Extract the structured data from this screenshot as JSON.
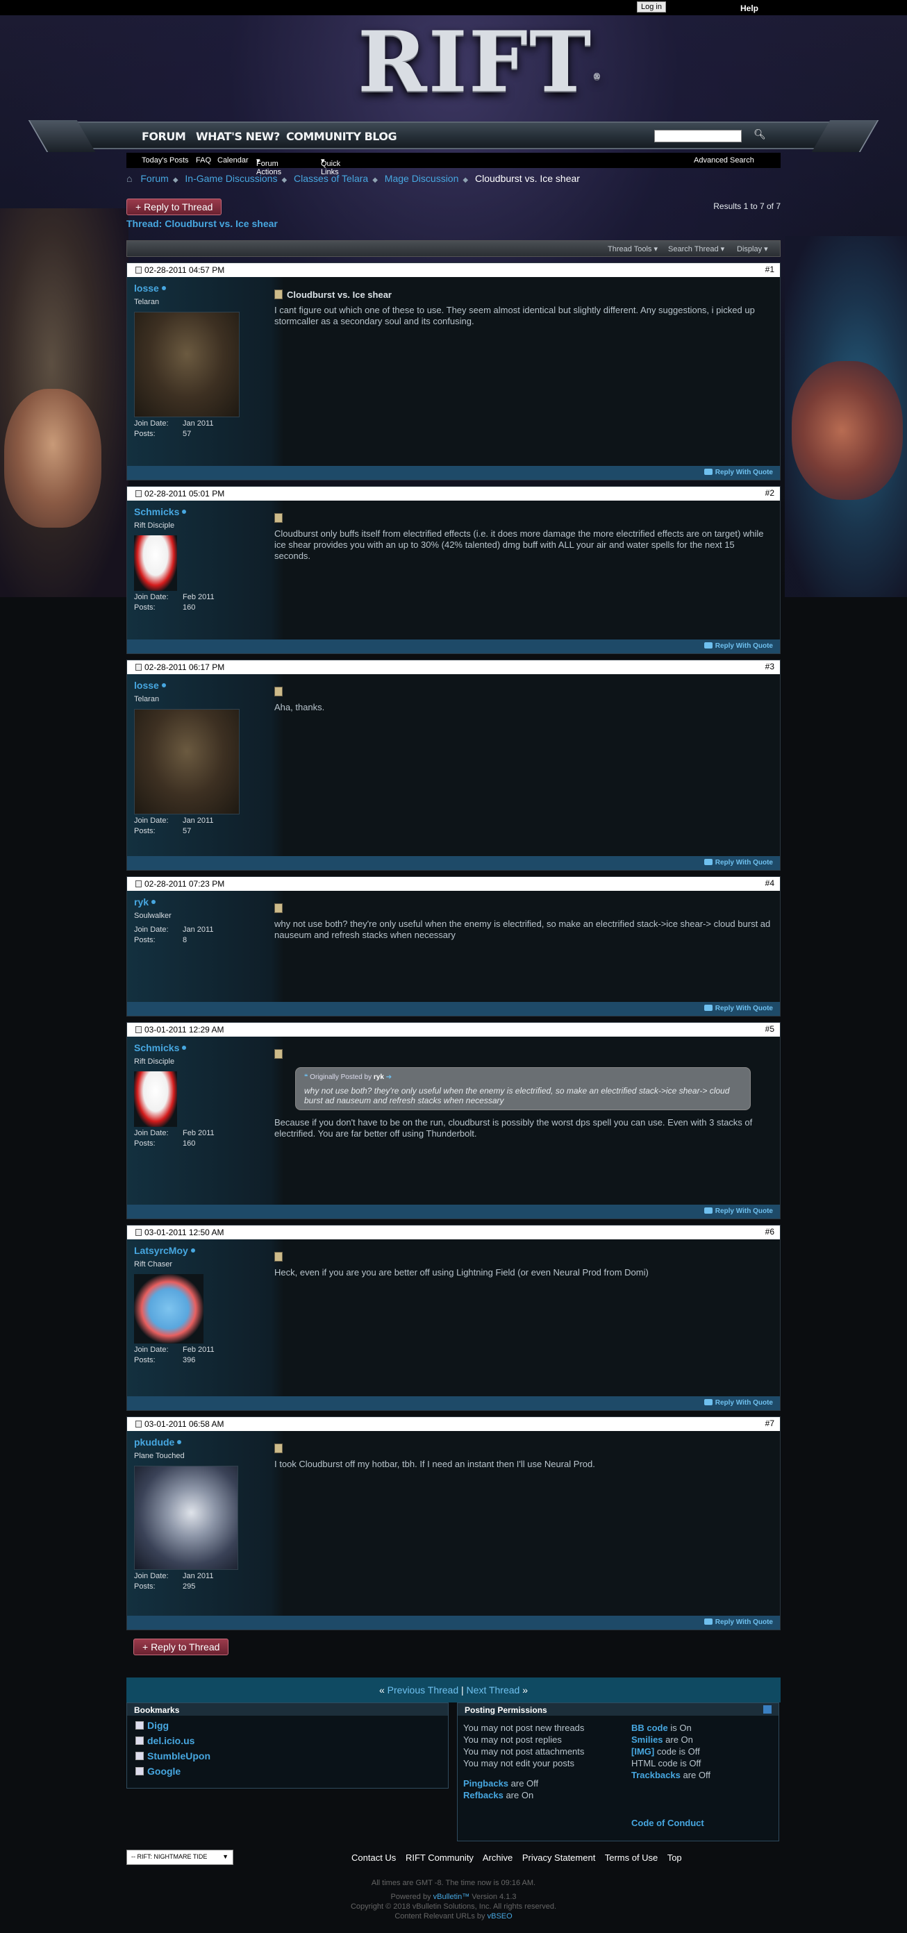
{
  "topbar": {
    "login": "Log in",
    "help": "Help"
  },
  "logo": {
    "text": "RIFT",
    "mark": "®"
  },
  "nav": {
    "items": [
      "FORUM",
      "WHAT'S NEW?",
      "COMMUNITY BLOG"
    ],
    "search_placeholder": ""
  },
  "subnav": {
    "todays_posts": "Today's Posts",
    "faq": "FAQ",
    "calendar": "Calendar",
    "forum_actions": "Forum Actions",
    "quick_links": "Quick Links",
    "advanced_search": "Advanced Search"
  },
  "breadcrumb": [
    "Forum",
    "In-Game Discussions",
    "Classes of Telara",
    "Mage Discussion"
  ],
  "breadcrumb_current": "Cloudburst vs. Ice shear",
  "reply_label": "+ Reply to Thread",
  "results": "Results 1 to 7 of 7",
  "thread_title": "Thread: Cloudburst vs. Ice shear",
  "tools": {
    "thread_tools": "Thread Tools",
    "search_thread": "Search Thread",
    "display": "Display"
  },
  "reply_with_quote": "Reply With Quote",
  "join_label": "Join Date:",
  "posts_label": "Posts:",
  "posts": [
    {
      "date": "02-28-2011 04:57 PM",
      "num": "#1",
      "user": "losse",
      "title": "Telaran",
      "join": "Jan 2011",
      "count": "57",
      "post_title": "Cloudburst vs. Ice shear",
      "text": "I cant figure out which one of these to use. They seem almost identical but slightly different. Any suggestions, i picked up stormcaller as a secondary soul and its confusing."
    },
    {
      "date": "02-28-2011 05:01 PM",
      "num": "#2",
      "user": "Schmicks",
      "title": "Rift Disciple",
      "join": "Feb 2011",
      "count": "160",
      "text": "Cloudburst only buffs itself from electrified effects (i.e. it does more damage the more electrified effects are on target) while ice shear provides you with an up to 30% (42% talented) dmg buff with ALL your air and water spells for the next 15 seconds."
    },
    {
      "date": "02-28-2011 06:17 PM",
      "num": "#3",
      "user": "losse",
      "title": "Telaran",
      "join": "Jan 2011",
      "count": "57",
      "text": "Aha, thanks."
    },
    {
      "date": "02-28-2011 07:23 PM",
      "num": "#4",
      "user": "ryk",
      "title": "Soulwalker",
      "join": "Jan 2011",
      "count": "8",
      "text": "why not use both? they're only useful when the enemy is electrified, so make an electrified stack->ice shear-> cloud burst ad nauseum and refresh stacks when necessary"
    },
    {
      "date": "03-01-2011 12:29 AM",
      "num": "#5",
      "user": "Schmicks",
      "title": "Rift Disciple",
      "join": "Feb 2011",
      "count": "160",
      "quote_header": "Originally Posted by",
      "quote_user": "ryk",
      "quote_text": "why not use both? they're only useful when the enemy is electrified, so make an electrified stack->ice shear-> cloud burst ad nauseum and refresh stacks when necessary",
      "text": "Because if you don't have to be on the run, cloudburst is possibly the worst dps spell you can use. Even with 3 stacks of electrified. You are far better off using Thunderbolt."
    },
    {
      "date": "03-01-2011 12:50 AM",
      "num": "#6",
      "user": "LatsyrcMoy",
      "title": "Rift Chaser",
      "join": "Feb 2011",
      "count": "396",
      "text": "Heck, even if you are you are better off using Lightning Field (or even Neural Prod from Domi)"
    },
    {
      "date": "03-01-2011 06:58 AM",
      "num": "#7",
      "user": "pkudude",
      "title": "Plane Touched",
      "join": "Jan 2011",
      "count": "295",
      "text": "I took Cloudburst off my hotbar, tbh. If I need an instant then I'll use Neural Prod."
    }
  ],
  "thread_nav": {
    "prev": "Previous Thread",
    "next": "Next Thread",
    "left": "«",
    "sep": "|",
    "right": "»"
  },
  "bookmarks": {
    "title": "Bookmarks",
    "items": [
      "Digg",
      "del.icio.us",
      "StumbleUpon",
      "Google"
    ]
  },
  "permissions": {
    "title": "Posting Permissions",
    "left": [
      "You may not post new threads",
      "You may not post replies",
      "You may not post attachments",
      "You may not edit your posts"
    ],
    "bbcode": "BB code",
    "bbcode_state": "is On",
    "smilies": "Smilies",
    "smilies_state": "are On",
    "img": "[IMG]",
    "img_state": "code is Off",
    "html": "HTML code is Off",
    "trackbacks": "Trackbacks",
    "trackbacks_state": "are Off",
    "pingbacks": "Pingbacks",
    "pingbacks_state": "are Off",
    "refbacks": "Refbacks",
    "refbacks_state": "are On",
    "conduct": "Code of Conduct"
  },
  "style_select": "-- RIFT: NIGHTMARE TIDE",
  "footer": [
    "Contact Us",
    "RIFT Community",
    "Archive",
    "Privacy Statement",
    "Terms of Use",
    "Top"
  ],
  "footnotes": {
    "time": "All times are GMT -8. The time now is 09:16 AM.",
    "powered_pre": "Powered by",
    "vbulletin": "vBulletin™",
    "version": "Version 4.1.3",
    "copyright": "Copyright © 2018 vBulletin Solutions, Inc. All rights reserved.",
    "seo_pre": "Content Relevant URLs by",
    "vbseo": "vBSEO"
  }
}
